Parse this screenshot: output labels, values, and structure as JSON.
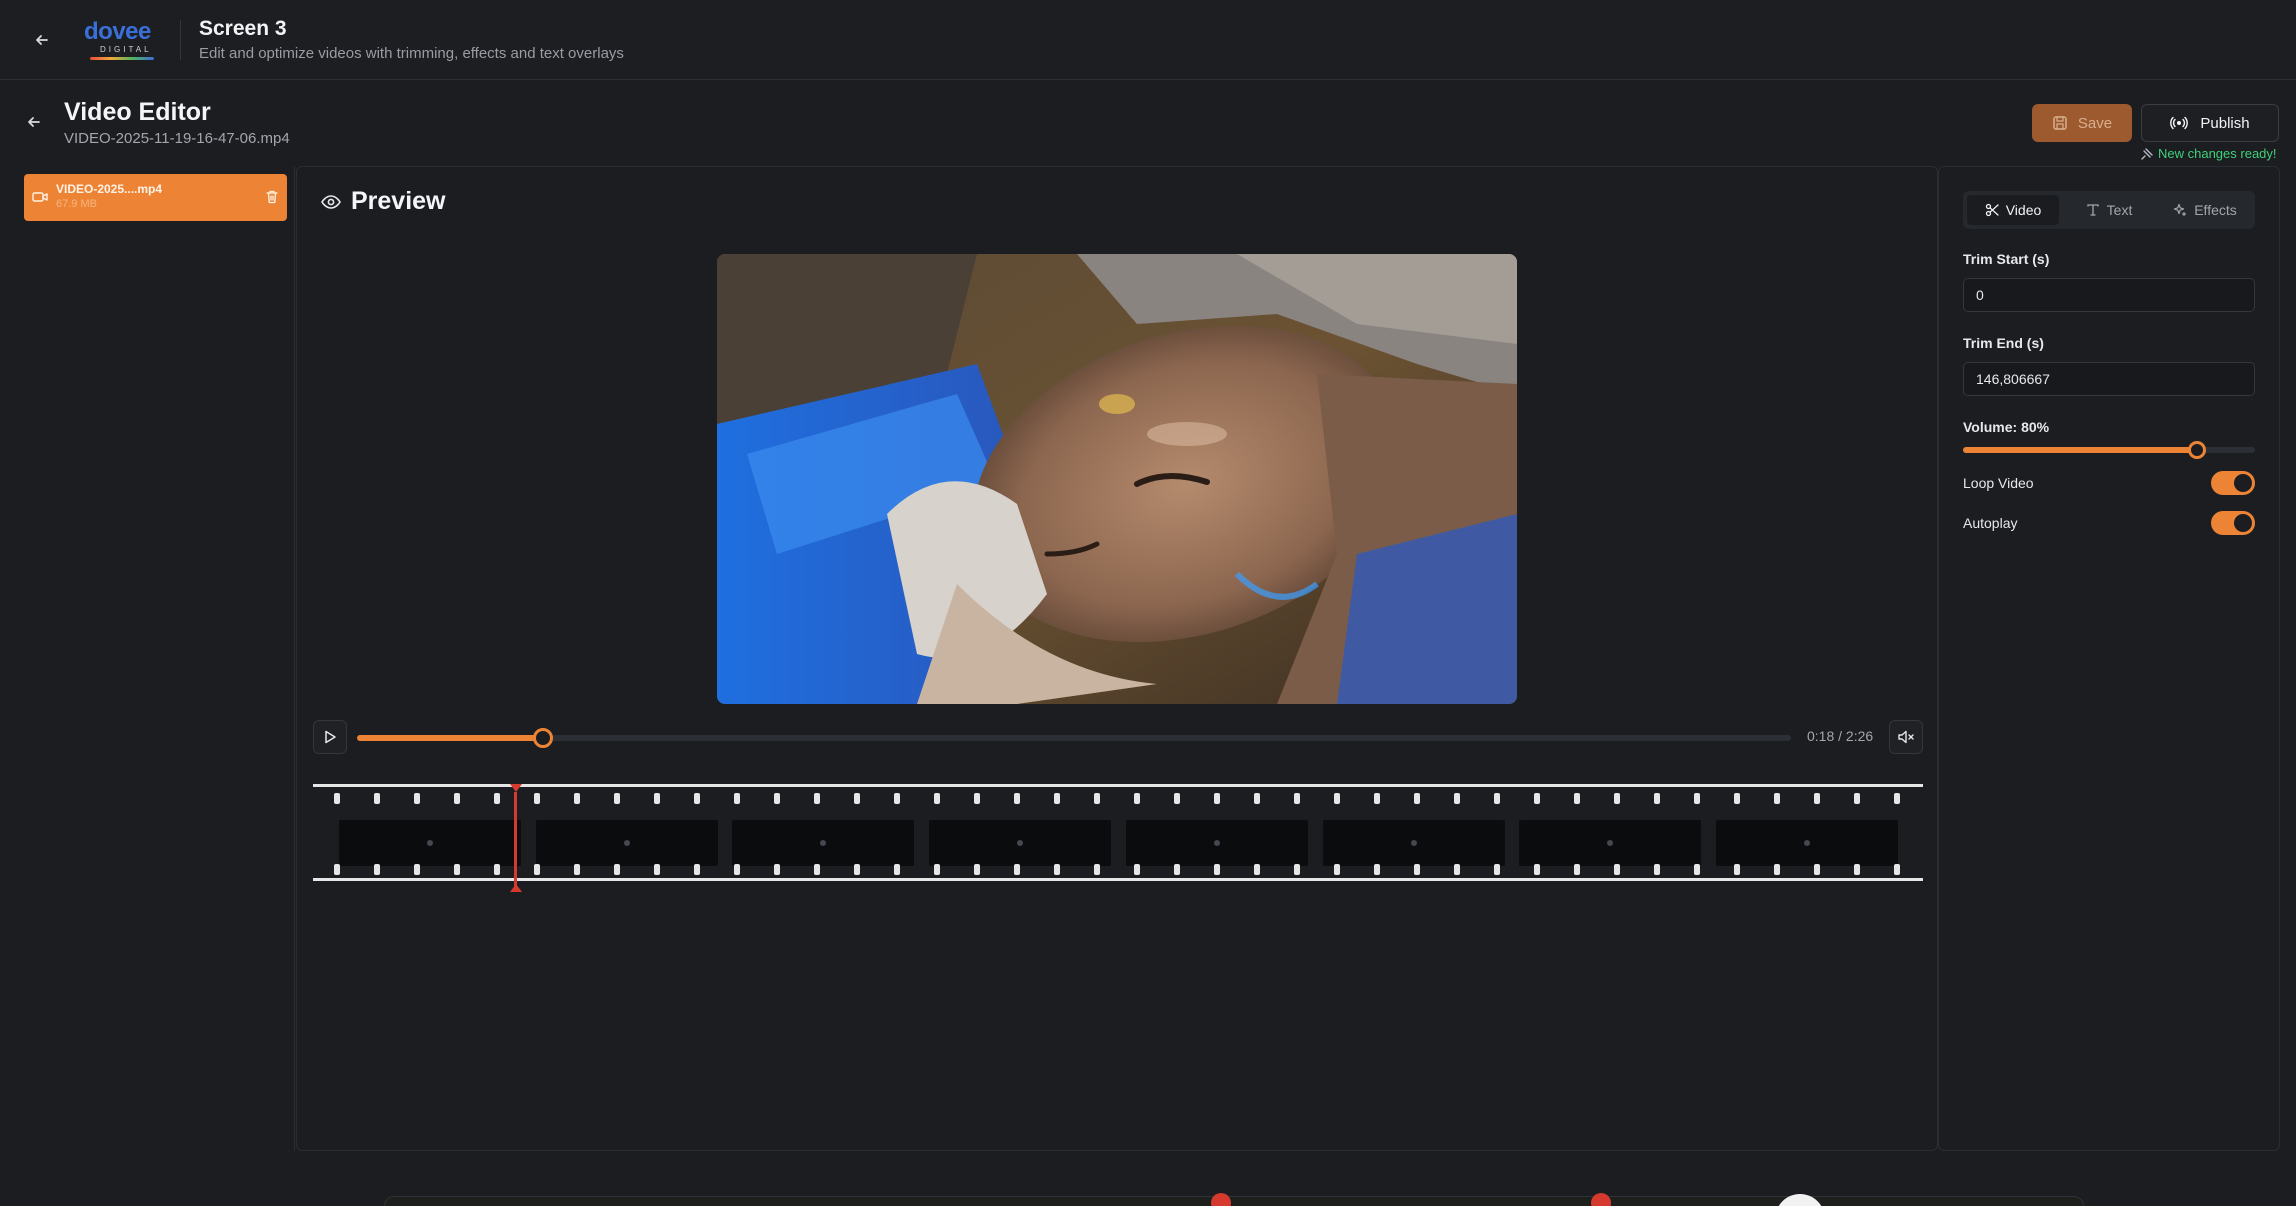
{
  "app": {
    "logo_text": "dovee",
    "logo_sub": "DIGITAL",
    "title": "Screen 3",
    "subtitle": "Edit and optimize videos with trimming, effects and text overlays"
  },
  "editor": {
    "title": "Video Editor",
    "file_name": "VIDEO-2025-11-19-16-47-06.mp4",
    "save_label": "Save",
    "publish_label": "Publish",
    "status_message": "New changes ready!"
  },
  "files": [
    {
      "name": "VIDEO-2025....mp4",
      "size": "67.9 MB"
    }
  ],
  "preview": {
    "title": "Preview",
    "time": "0:18 / 2:26",
    "progress": 0.13,
    "playhead_fraction": 0.126
  },
  "settings": {
    "tabs": [
      {
        "label": "Video",
        "icon": "scissors-icon",
        "active": true
      },
      {
        "label": "Text",
        "icon": "text-icon",
        "active": false
      },
      {
        "label": "Effects",
        "icon": "sparkles-icon",
        "active": false
      }
    ],
    "trim_start_label": "Trim Start (s)",
    "trim_start_value": "0",
    "trim_end_label": "Trim End (s)",
    "trim_end_value": "146,806667",
    "volume_label": "Volume: 80%",
    "volume": 0.8,
    "loop_label": "Loop Video",
    "loop_on": true,
    "autoplay_label": "Autoplay",
    "autoplay_on": true
  },
  "colors": {
    "accent": "#ed8435",
    "status": "#3fd07a",
    "playhead": "#d63a2f"
  }
}
